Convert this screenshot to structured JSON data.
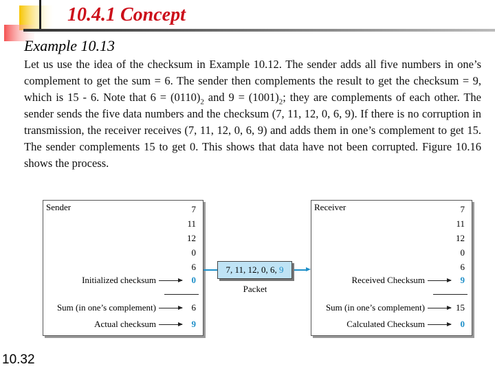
{
  "slide": {
    "title": "10.4.1 Concept",
    "subtitle": "Example 10.13",
    "page_number": "10.32",
    "accent_color": "#cc0f1a",
    "paragraph": {
      "p1": "Let us use the idea of the checksum in Example 10.12. The sender adds all five numbers in one’s complement to get the sum = 6. The sender then complements the result to get the checksum = 9, which is 15 - 6. Note that 6 = (0110)",
      "s1": "2",
      "p2": " and 9 = (1001)",
      "s2": "2",
      "p3": "; they are complements of each other. The sender sends the five data numbers and the checksum (7, 11, 12, 0, 6, 9). If there is no corruption in transmission, the receiver receives (7, 11, 12, 0, 6, 9) and adds them in one’s complement to get 15. The sender complements 15 to get 0. This shows that data have not been corrupted. Figure 10.16 shows the process."
    }
  },
  "figure": {
    "highlight_color": "#1e8fc8",
    "sender": {
      "label": "Sender",
      "numbers": [
        "7",
        "11",
        "12",
        "0",
        "6"
      ],
      "init_label": "Initialized checksum",
      "init_value": "0",
      "sum_label": "Sum (in one’s complement)",
      "sum_value": "6",
      "checksum_label": "Actual checksum",
      "checksum_value": "9"
    },
    "packet": {
      "data": "7, 11, 12, 0, 6, ",
      "checksum": "9",
      "label": "Packet"
    },
    "receiver": {
      "label": "Receiver",
      "numbers": [
        "7",
        "11",
        "12",
        "0",
        "6"
      ],
      "recv_label": "Received Checksum",
      "recv_value": "9",
      "sum_label": "Sum (in one’s complement)",
      "sum_value": "15",
      "checksum_label": "Calculated Checksum",
      "checksum_value": "0"
    }
  }
}
